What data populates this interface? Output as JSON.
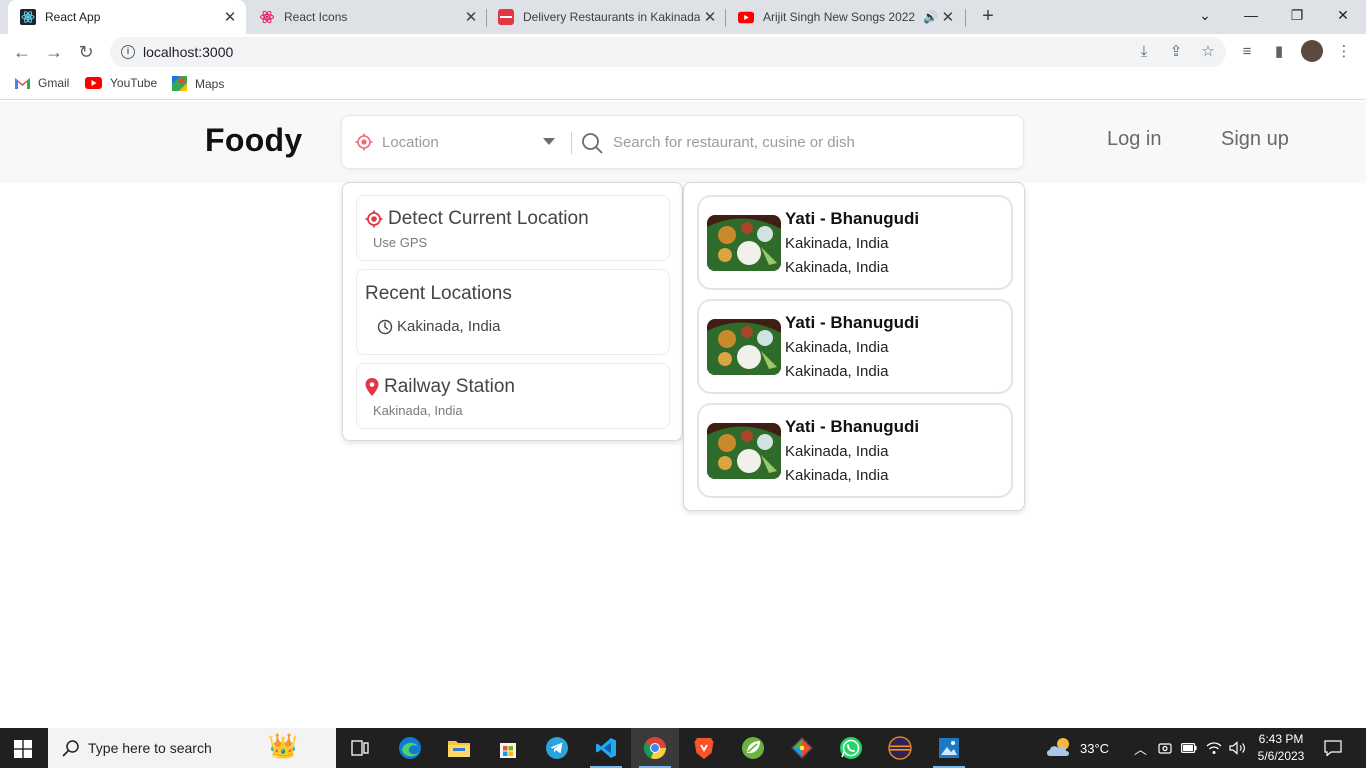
{
  "browser": {
    "tabs": [
      {
        "title": "React App",
        "active": true
      },
      {
        "title": "React Icons",
        "active": false
      },
      {
        "title": "Delivery Restaurants in Kakinada",
        "active": false
      },
      {
        "title": "Arijit Singh New Songs 2022",
        "active": false
      }
    ],
    "url": "localhost:3000",
    "bookmarks": [
      "Gmail",
      "YouTube",
      "Maps"
    ]
  },
  "page": {
    "logo": "Foody",
    "search": {
      "location_placeholder": "Location",
      "query_placeholder": "Search for restaurant, cusine or dish"
    },
    "auth": {
      "login": "Log in",
      "signup": "Sign up"
    },
    "location_dropdown": {
      "detect": {
        "title": "Detect Current Location",
        "subtitle": "Use GPS"
      },
      "recent": {
        "title": "Recent Locations",
        "item": "Kakinada, India"
      },
      "suggestion": {
        "title": "Railway Station",
        "subtitle": "Kakinada, India"
      }
    },
    "results": [
      {
        "name": "Yati - Bhanugudi",
        "line1": "Kakinada, India",
        "line2": "Kakinada, India"
      },
      {
        "name": "Yati - Bhanugudi",
        "line1": "Kakinada, India",
        "line2": "Kakinada, India"
      },
      {
        "name": "Yati - Bhanugudi",
        "line1": "Kakinada, India",
        "line2": "Kakinada, India"
      }
    ],
    "colors": {
      "accent": "#e23744",
      "text_muted": "#9c9c9c"
    }
  },
  "taskbar": {
    "search_placeholder": "Type here to search",
    "weather": "33°C",
    "time": "6:43 PM",
    "date": "5/6/2023"
  }
}
